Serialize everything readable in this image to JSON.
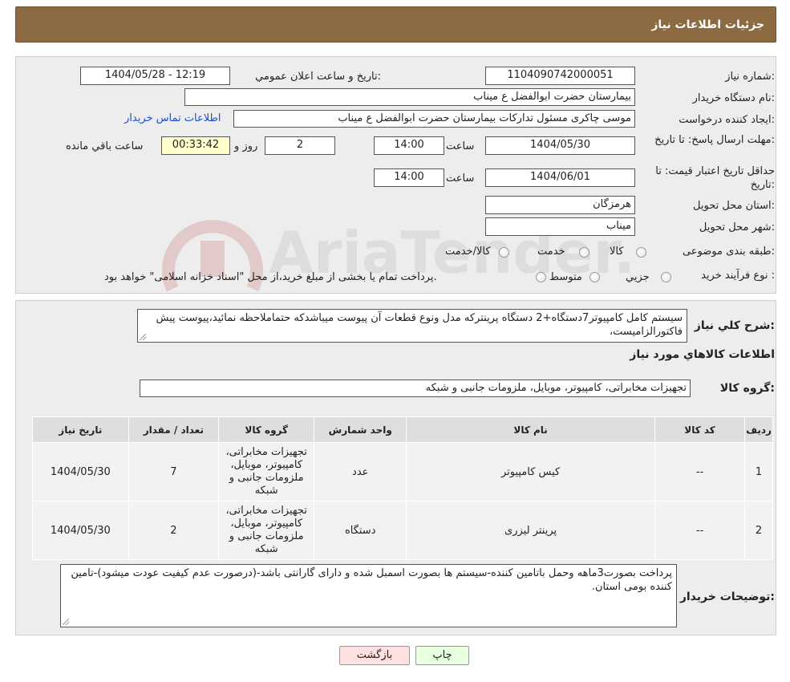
{
  "header": {
    "title": "جزئیات اطلاعات نیاز"
  },
  "form": {
    "need_number_label": "شماره نیاز:",
    "need_number": "1104090742000051",
    "announce_label": "تاریخ و ساعت اعلان عمومي:",
    "announce_value": "1404/05/28 - 12:19",
    "buyer_org_label": "نام دستگاه خریدار:",
    "buyer_org": "بیمارستان حضرت ابوالفضل ع  میناب",
    "creator_label": "ایجاد کننده درخواست:",
    "creator": "موسی چاکری مسئول تدارکات بیمارستان حضرت ابوالفضل ع  میناب",
    "contact_link": "اطلاعات تماس خریدار",
    "deadline_label": "مهلت ارسال پاسخ: تا تاریخ:",
    "deadline_date": "1404/05/30",
    "time_label": "ساعت",
    "deadline_time": "14:00",
    "days_value": "2",
    "days_label": "روز و",
    "remaining_value": "00:33:42",
    "remaining_label": "ساعت باقي مانده",
    "validity_label": "حداقل تاریخ اعتبار قیمت: تا تاریخ:",
    "validity_date": "1404/06/01",
    "validity_time": "14:00",
    "province_label": "استان محل تحویل:",
    "province": "هرمزگان",
    "city_label": "شهر محل تحویل:",
    "city": "میناب",
    "category_label": "طبقه بندی موضوعی:",
    "category_options": [
      "کالا",
      "خدمت",
      "کالا/خدمت"
    ],
    "process_label": "نوع فرآیند خرید :",
    "process_options": [
      "جزیي",
      "متوسط"
    ],
    "process_note": "پرداخت تمام یا بخشی از مبلغ خرید،از محل \"اسناد خزانه اسلامی\" خواهد بود."
  },
  "summary": {
    "label": "شرح کلي نیاز:",
    "text": "سیستم کامل کامپیوتر7دستگاه+2 دستگاه پرینترکه مدل ونوع قطعات آن پیوست میباشدکه حتماملاحظه نمائید،پیوست پیش فاکتورالزامیست،"
  },
  "goods": {
    "section_title": "اطلاعات کالاهاي مورد نیاز",
    "group_label": "گروه کالا:",
    "group_value": "تجهیزات مخابراتی، کامپیوتر، موبایل، ملزومات جانبی و شبکه",
    "columns": [
      "ردیف",
      "کد کالا",
      "نام کالا",
      "واحد شمارش",
      "گروه کالا",
      "تعداد / مقدار",
      "تاریخ نیاز"
    ],
    "rows": [
      {
        "index": "1",
        "code": "--",
        "name": "کیس کامپیوتر",
        "unit": "عدد",
        "group": "تجهیزات مخابراتی، کامپیوتر، موبایل، ملزومات جانبی و شبکه",
        "qty": "7",
        "date": "1404/05/30"
      },
      {
        "index": "2",
        "code": "--",
        "name": "پرینتر لیزری",
        "unit": "دستگاه",
        "group": "تجهیزات مخابراتی، کامپیوتر، موبایل، ملزومات جانبی و شبکه",
        "qty": "2",
        "date": "1404/05/30"
      }
    ]
  },
  "buyer_notes": {
    "label": "توضیحات خریدار:",
    "text": "پرداخت بصورت3ماهه وحمل باتامین کننده-سیستم ها بصورت اسمبل شده و دارای گارانتی باشد-(درصورت عدم کیفیت عودت میشود)-تامین کننده بومی استان."
  },
  "buttons": {
    "print": "چاپ",
    "back": "بازگشت"
  },
  "watermark": {
    "text": "AriaTender.neT"
  },
  "colors": {
    "header_bg": "#8d6b42",
    "panel_bg": "#ededed",
    "link": "#1b4fd1",
    "back_button_bg": "#ffe0e0",
    "print_button_bg": "#e8ffe0",
    "yellow_field": "#ffffcc"
  }
}
